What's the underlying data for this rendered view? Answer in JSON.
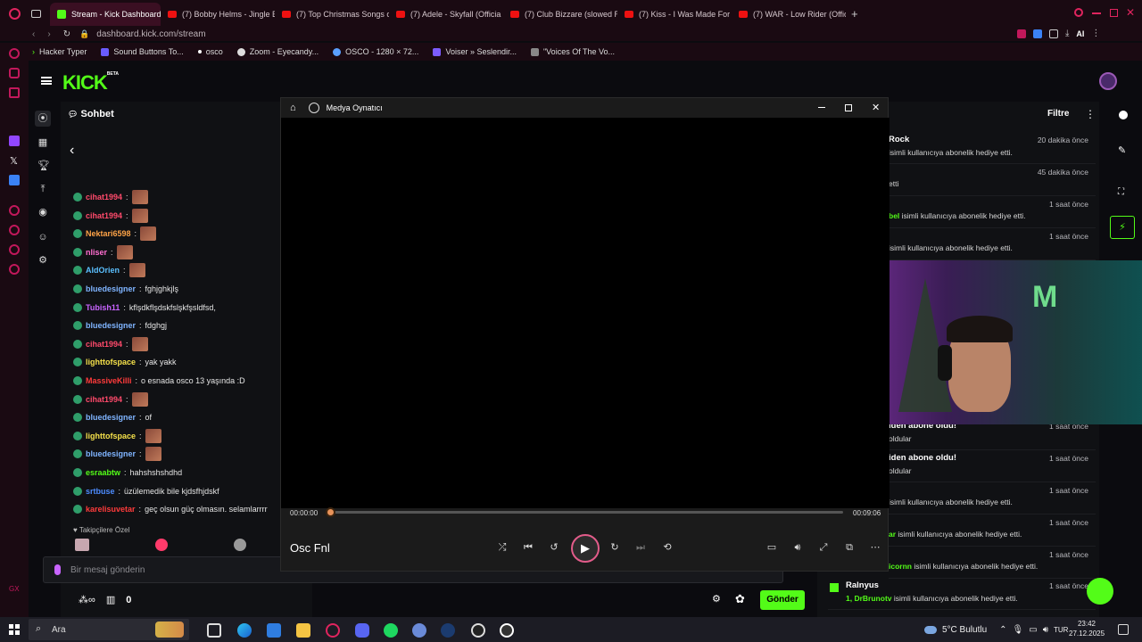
{
  "browser": {
    "tabs": [
      {
        "label": "Stream - Kick Dashboard",
        "active": true,
        "icon": "kick-icon"
      },
      {
        "label": "(7) Bobby Helms - Jingle B",
        "icon": "youtube-icon"
      },
      {
        "label": "(7) Top Christmas Songs o",
        "icon": "youtube-icon"
      },
      {
        "label": "(7) Adele - Skyfall (Officia",
        "icon": "youtube-icon"
      },
      {
        "label": "(7) Club Bizzare (slowed R",
        "icon": "youtube-icon"
      },
      {
        "label": "(7) Kiss - I Was Made For",
        "icon": "youtube-icon"
      },
      {
        "label": "(7) WAR - Low Rider (Offic",
        "icon": "youtube-icon"
      }
    ],
    "new_tab": "+",
    "url": "dashboard.kick.com/stream",
    "bookmarks": [
      "Hacker Typer",
      "Sound Buttons To...",
      "osco",
      "Zoom - Eyecandy...",
      "OSCO - 1280 × 72...",
      "Voiser » Seslendir...",
      "\"Voices Of The Vo..."
    ],
    "ai_label": "AI"
  },
  "kick": {
    "logo": "KICK",
    "logo_beta": "BETA"
  },
  "chat": {
    "title": "Sohbet",
    "messages": [
      {
        "user": "cihat1994",
        "text": "",
        "color": "#ff4a6b",
        "emote": true
      },
      {
        "user": "cihat1994",
        "text": "",
        "color": "#ff4a6b",
        "emote": true
      },
      {
        "user": "Nektari6598",
        "text": "",
        "color": "#ffa347",
        "emote": true
      },
      {
        "user": "nliser",
        "text": "",
        "color": "#ff6ed0",
        "emote": true
      },
      {
        "user": "AldOrien",
        "text": "",
        "color": "#5bc0ff",
        "emote": true
      },
      {
        "user": "bluedesigner",
        "text": "fghjghkjlş",
        "color": "#7fb4ff"
      },
      {
        "user": "Tubish11",
        "text": "kflşdkflşdskfslşkfşsldfsd,",
        "color": "#c864ff"
      },
      {
        "user": "bluedesigner",
        "text": "fdghgj",
        "color": "#7fb4ff"
      },
      {
        "user": "cihat1994",
        "text": "",
        "color": "#ff4a6b",
        "emote": true
      },
      {
        "user": "lighttofspace",
        "text": "yak yakk",
        "color": "#f4e04a"
      },
      {
        "user": "MassiveKilli",
        "text": "o esnada osco 13 yaşında :D",
        "color": "#ff3b3b"
      },
      {
        "user": "cihat1994",
        "text": "",
        "color": "#ff4a6b",
        "emote": true
      },
      {
        "user": "bluedesigner",
        "text": "of",
        "color": "#7fb4ff"
      },
      {
        "user": "lighttofspace",
        "text": "",
        "color": "#f4e04a",
        "emote": true
      },
      {
        "user": "bluedesigner",
        "text": "",
        "color": "#7fb4ff",
        "emote": true
      },
      {
        "user": "esraabtw",
        "text": "hahshshshdhd",
        "color": "#53fc18"
      },
      {
        "user": "srtbuse",
        "text": "üzülemedik bile kjdsfhjdskf",
        "color": "#4d8cff"
      },
      {
        "user": "karelisuvetar",
        "text": "geç olsun güç olmasın. selamlarrrr",
        "color": "#ff3b3b"
      }
    ],
    "followers_label": "Takipçilere Özel",
    "input_placeholder": "Bir mesaj gönderin",
    "points": "0",
    "send_label": "Gönder"
  },
  "feed": {
    "filter_label": "Filtre",
    "items": [
      {
        "name": "Rock",
        "desc": "isimli kullanıcıya abonelik hediye etti.",
        "time": "20 dakika önce"
      },
      {
        "name": "",
        "desc": "etti",
        "time": "45 dakika önce"
      },
      {
        "name": "",
        "highlight": "bel",
        "desc": "isimli kullanıcıya abonelik hediye etti.",
        "time": "1 saat önce"
      },
      {
        "name": "",
        "desc": "isimli kullanıcıya abonelik hediye etti.",
        "time": "1 saat önce"
      },
      {
        "name": "iden abone oldu!",
        "desc": "oldular",
        "time": "1 saat önce"
      },
      {
        "name": "iden abone oldu!",
        "desc": "oldular",
        "time": "1 saat önce"
      },
      {
        "name": "",
        "desc": "isimli kullanıcıya abonelik hediye etti.",
        "time": "1 saat önce"
      },
      {
        "name": "",
        "highlight": "ar",
        "desc": "isimli kullanıcıya abonelik hediye etti.",
        "time": "1 saat önce"
      },
      {
        "name": "",
        "highlight": "icornn",
        "desc": "isimli kullanıcıya abonelik hediye etti.",
        "time": "1 saat önce"
      },
      {
        "name": "Ralnyus",
        "prefix": "1,",
        "highlight": "DrBrunotv",
        "desc": "isimli kullanıcıya abonelik hediye etti.",
        "time": "1 saat önce"
      }
    ]
  },
  "player": {
    "app_title": "Medya Oynatıcı",
    "track_title": "Osc Fnl",
    "elapsed": "00:00:00",
    "duration": "00:09:06",
    "progress": 0.0
  },
  "taskbar": {
    "search_placeholder": "Ara",
    "weather": "5°C Bulutlu",
    "language": "TUR",
    "time": "23:42",
    "date": "27.12.2025"
  },
  "colors": {
    "kick_green": "#53fc18",
    "accent_pink": "#e25c8a",
    "opera_red": "#c2185b"
  }
}
